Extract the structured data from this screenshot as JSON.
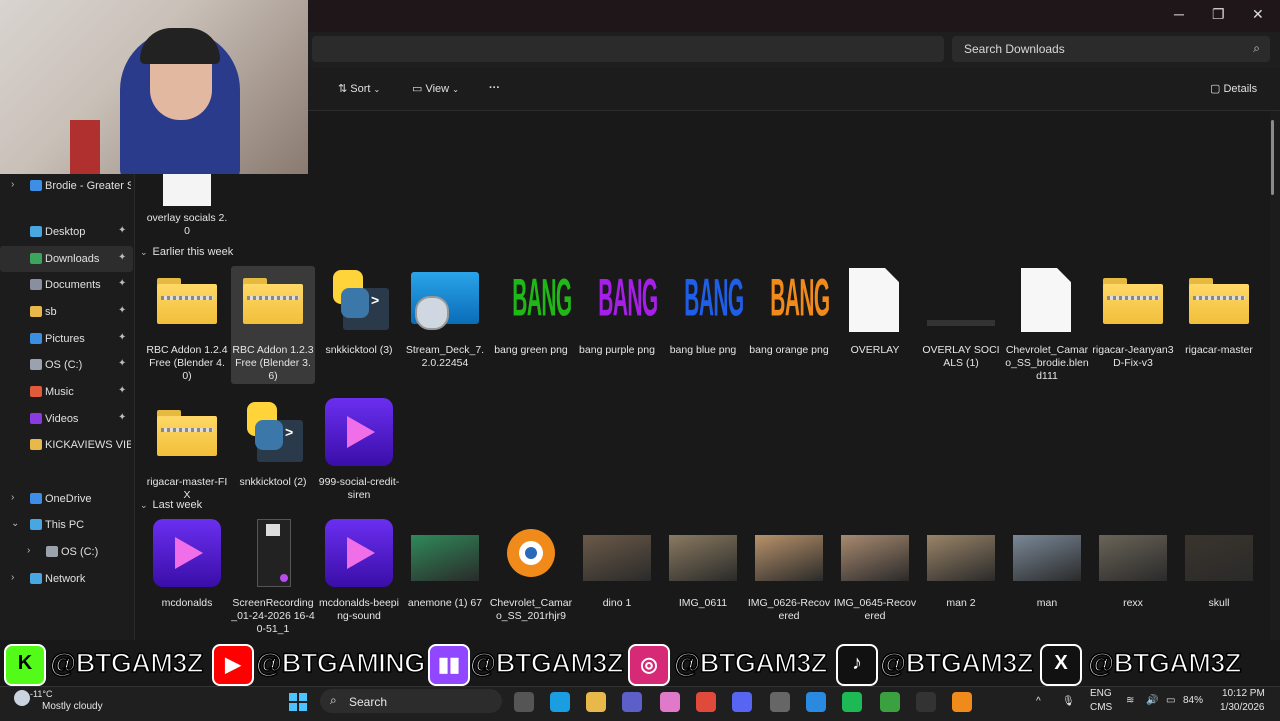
{
  "window": {
    "search_placeholder": "Search Downloads",
    "controls": [
      "─",
      "❐",
      "✕"
    ]
  },
  "toolbar": {
    "sort_label": "Sort",
    "view_label": "View",
    "more_label": "···",
    "details_label": "Details"
  },
  "sidebar": {
    "items": [
      {
        "label": "Brodie - Greater Sa",
        "icon": "cloud-icon",
        "color": "#3d8ee6"
      },
      {
        "label": "Desktop",
        "icon": "desktop-icon",
        "color": "#48a6e0"
      },
      {
        "label": "Downloads",
        "icon": "download-icon",
        "color": "#3ba55d"
      },
      {
        "label": "Documents",
        "icon": "document-icon",
        "color": "#8a8fa0"
      },
      {
        "label": "sb",
        "icon": "folder-icon",
        "color": "#e8b84a"
      },
      {
        "label": "Pictures",
        "icon": "pictures-icon",
        "color": "#3b8fe0"
      },
      {
        "label": "OS (C:)",
        "icon": "drive-icon",
        "color": "#9aa3ad"
      },
      {
        "label": "Music",
        "icon": "music-icon",
        "color": "#e05a3b"
      },
      {
        "label": "Videos",
        "icon": "videos-icon",
        "color": "#8a3be0"
      },
      {
        "label": "KICKAVIEWS VIEWE",
        "icon": "folder-icon",
        "color": "#e8b84a"
      },
      {
        "label": "OneDrive",
        "icon": "cloud-icon",
        "color": "#3d8ee6"
      },
      {
        "label": "This PC",
        "icon": "pc-icon",
        "color": "#48a6e0"
      },
      {
        "label": "OS (C:)",
        "icon": "drive-icon",
        "color": "#9aa3ad"
      },
      {
        "label": "Network",
        "icon": "network-icon",
        "color": "#48a6e0"
      }
    ]
  },
  "sections": {
    "earlier": "Earlier this week",
    "last_week": "Last week"
  },
  "files": {
    "top": {
      "label": "overlay socials 2.0"
    },
    "earlier": [
      {
        "label": "RBC Addon 1.2.4 Free (Blender 4.0)",
        "kind": "zip-folder"
      },
      {
        "label": "RBC Addon 1.2.3 Free (Blender 3.6)",
        "kind": "zip-folder"
      },
      {
        "label": "snkkicktool (3)",
        "kind": "python"
      },
      {
        "label": "Stream_Deck_7.2.0.22454",
        "kind": "installer"
      },
      {
        "label": "bang green png",
        "kind": "bang",
        "text": "BANG",
        "color": "#1fb816"
      },
      {
        "label": "bang purple png",
        "kind": "bang",
        "text": "BANG",
        "color": "#a51fe8"
      },
      {
        "label": "bang blue png",
        "kind": "bang",
        "text": "BANG",
        "color": "#1f5ee8"
      },
      {
        "label": "bang orange png",
        "kind": "bang",
        "text": "BANG",
        "color": "#f08a1a"
      },
      {
        "label": "OVERLAY",
        "kind": "document"
      },
      {
        "label": "OVERLAY SOCIALS (1)",
        "kind": "dark-image"
      },
      {
        "label": "Chevrolet_Camaro_SS_brodie.blend111",
        "kind": "document"
      },
      {
        "label": "rigacar-Jeanyan3D-Fix-v3",
        "kind": "zip-folder"
      },
      {
        "label": "rigacar-master",
        "kind": "zip-folder"
      },
      {
        "label": "rigacar-master-FIX",
        "kind": "zip-folder"
      },
      {
        "label": "snkkicktool (2)",
        "kind": "python"
      },
      {
        "label": "999-social-credit-siren",
        "kind": "video"
      }
    ],
    "last_week": [
      {
        "label": "mcdonalds",
        "kind": "video"
      },
      {
        "label": "ScreenRecording_01-24-2026 16-40-51_1",
        "kind": "screen-recording"
      },
      {
        "label": "mcdonalds-beeping-sound",
        "kind": "video"
      },
      {
        "label": "anemone (1) 67",
        "kind": "photo",
        "color": "#2f8a5a"
      },
      {
        "label": "Chevrolet_Camaro_SS_201rhjr9",
        "kind": "blender"
      },
      {
        "label": "dino 1",
        "kind": "photo",
        "color": "#6b5a48"
      },
      {
        "label": "IMG_0611",
        "kind": "photo",
        "color": "#8a7a60"
      },
      {
        "label": "IMG_0626-Recovered",
        "kind": "photo",
        "color": "#b8926a"
      },
      {
        "label": "IMG_0645-Recovered",
        "kind": "photo",
        "color": "#a88a70"
      },
      {
        "label": "man 2",
        "kind": "photo",
        "color": "#9a8468"
      },
      {
        "label": "man",
        "kind": "photo",
        "color": "#7a8898"
      },
      {
        "label": "rexx",
        "kind": "photo",
        "color": "#6a6458"
      },
      {
        "label": "skull",
        "kind": "photo",
        "color": "#3a342c"
      }
    ]
  },
  "social": {
    "handles": [
      "@BTGAM3Z",
      "@BTGAMING",
      "@BTGAM3Z",
      "@BTGAM3Z",
      "@BTGAM3Z",
      "@BTGAM3Z"
    ],
    "icons": [
      {
        "name": "kick-icon",
        "color": "#53fc18",
        "glyph": "K"
      },
      {
        "name": "youtube-icon",
        "color": "#ff0000",
        "glyph": "▶"
      },
      {
        "name": "twitch-icon",
        "color": "#9146ff",
        "glyph": "▮▮"
      },
      {
        "name": "instagram-icon",
        "color": "#d62976",
        "glyph": "◎"
      },
      {
        "name": "tiktok-icon",
        "color": "#111111",
        "glyph": "♪"
      },
      {
        "name": "x-icon",
        "color": "#111111",
        "glyph": "X"
      }
    ]
  },
  "taskbar": {
    "weather_temp": "-11°C",
    "weather_desc": "Mostly cloudy",
    "search_label": "Search",
    "lang1": "ENG",
    "lang2": "CMS",
    "battery": "84%",
    "time": "10:12 PM",
    "date": "1/30/2026"
  }
}
